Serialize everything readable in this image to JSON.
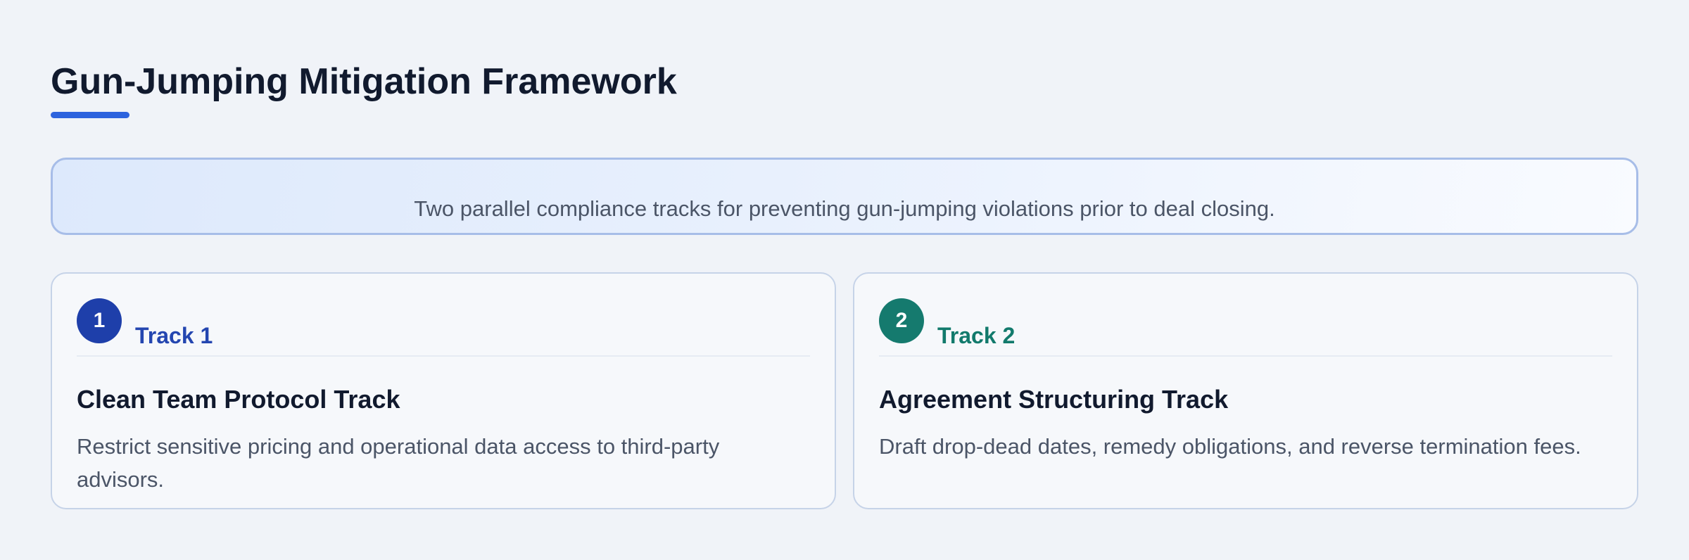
{
  "header": {
    "title": "Gun-Jumping Mitigation Framework"
  },
  "banner": {
    "text": "Two parallel compliance tracks for preventing gun-jumping violations prior to deal closing."
  },
  "tracks": [
    {
      "number": "1",
      "label": "Track 1",
      "heading": "Clean Team Protocol Track",
      "description": "Restrict sensitive pricing and operational data access to third-party advisors.",
      "color": "#1e3faa"
    },
    {
      "number": "2",
      "label": "Track 2",
      "heading": "Agreement Structuring Track",
      "description": "Draft drop-dead dates, remedy obligations, and reverse termination fees.",
      "color": "#157a6e"
    }
  ],
  "colors": {
    "accent": "#2d63de",
    "background": "#f0f3f8",
    "heading_text": "#111a2e",
    "body_text": "#4b5567"
  }
}
